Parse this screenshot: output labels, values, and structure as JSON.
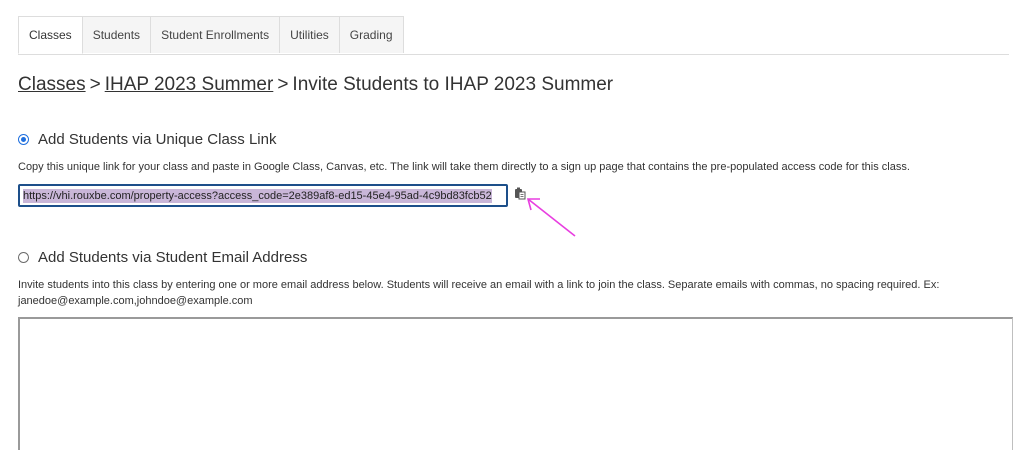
{
  "tabs": [
    {
      "label": "Classes",
      "active": true
    },
    {
      "label": "Students",
      "active": false
    },
    {
      "label": "Student Enrollments",
      "active": false
    },
    {
      "label": "Utilities",
      "active": false
    },
    {
      "label": "Grading",
      "active": false
    }
  ],
  "breadcrumb": {
    "item1": "Classes",
    "sep": ">",
    "item2": "IHAP 2023 Summer",
    "current": "Invite Students to IHAP 2023 Summer"
  },
  "link_section": {
    "label": "Add Students via Unique Class Link",
    "selected": true,
    "description": "Copy this unique link for your class and paste in Google Class, Canvas, etc. The link will take them directly to a sign up page that contains the pre-populated access code for this class.",
    "link_value": "https://vhi.rouxbe.com/property-access?access_code=2e389af8-ed15-45e4-95ad-4c9bd83fcb52",
    "copy_icon": "clipboard-icon"
  },
  "email_section": {
    "label": "Add Students via Student Email Address",
    "selected": false,
    "description_line1": "Invite students into this class by entering one or more email address below. Students will receive an email with a link to join the class. Separate emails with commas, no spacing required. Ex:",
    "description_line2": "janedoe@example.com,johndoe@example.com",
    "textarea_value": ""
  },
  "colors": {
    "accent": "#1f6fde",
    "selection_highlight": "#c9b6d8",
    "annotation_arrow": "#e83ee0"
  }
}
